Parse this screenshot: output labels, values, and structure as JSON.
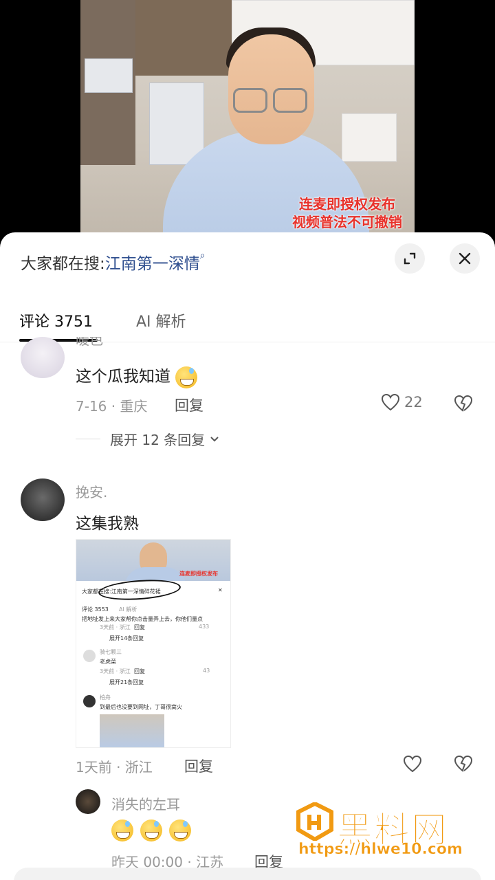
{
  "video": {
    "caption_line1": "连麦即授权发布",
    "caption_line2": "视频普法不可撤销"
  },
  "sheet": {
    "search_prefix": "大家都在搜:",
    "search_keyword": "江南第一深情",
    "tabs": [
      {
        "label": "评论 3751"
      },
      {
        "label": "AI 解析"
      }
    ]
  },
  "comments": [
    {
      "name": "暖色",
      "text": "这个瓜我知道",
      "emoji": "sweat-smile-emoji",
      "date_location": "7-16 · 重庆",
      "reply_label": "回复",
      "likes": "22",
      "expand_label": "展开 12 条回复"
    },
    {
      "name": "挽安.",
      "text": "这集我熟",
      "date_location": "1天前 · 浙江",
      "reply_label": "回复",
      "embedded_image": {
        "search_text": "大家都在搜:江南第一深情碎花裙",
        "tab1": "评论 3553",
        "tab2": "AI 解析",
        "row1_text": "把地址发上来大家帮你点击量弄上去，你他们量点",
        "row1_meta": "3天前 · 浙江",
        "row1_reply": "回复",
        "row1_likes": "433",
        "row1_expand": "展开14条回复",
        "row2_name": "骑七颗三",
        "row2_text": "老虎菜",
        "row2_meta": "3天前 · 浙江",
        "row2_reply": "回复",
        "row2_likes": "43",
        "row2_expand": "展开21条回复",
        "row3_name": "柏舟",
        "row3_text": "到最后也没要到网址，丁哥很窝火",
        "inner_caption": "连麦即授权发布"
      }
    },
    {
      "name": "消失的左耳",
      "emoji_count": 3,
      "meta_partial": "昨天 00:00 · 江苏",
      "reply_label": "回复"
    }
  ],
  "watermark": {
    "title": "黑料网",
    "url": "https://hlwe10.com"
  },
  "colors": {
    "keyword": "#2f4f8f",
    "caption": "#e8322b",
    "watermark": "#f19a12"
  }
}
